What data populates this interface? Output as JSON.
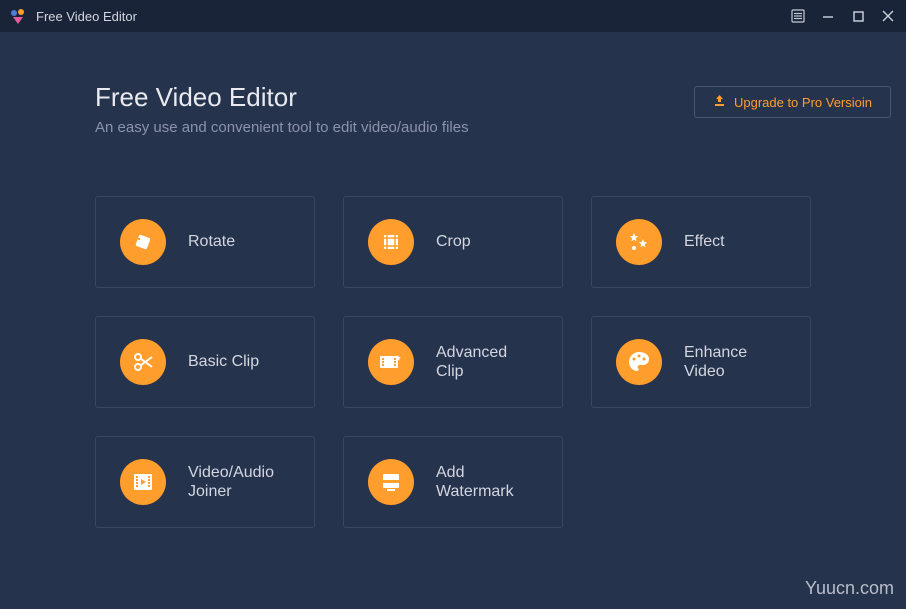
{
  "titlebar": {
    "app_name": "Free Video Editor"
  },
  "header": {
    "title": "Free Video Editor",
    "subtitle": "An easy use and convenient tool to edit video/audio files",
    "upgrade_label": "Upgrade to Pro Versioin"
  },
  "tools": [
    {
      "label": "Rotate",
      "icon": "rotate-icon"
    },
    {
      "label": "Crop",
      "icon": "crop-icon"
    },
    {
      "label": "Effect",
      "icon": "effect-icon"
    },
    {
      "label": "Basic Clip",
      "icon": "scissors-icon"
    },
    {
      "label": "Advanced Clip",
      "icon": "advanced-clip-icon"
    },
    {
      "label": "Enhance Video",
      "icon": "palette-icon"
    },
    {
      "label": "Video/Audio Joiner",
      "icon": "joiner-icon"
    },
    {
      "label": "Add Watermark",
      "icon": "watermark-icon"
    }
  ],
  "watermark_text": "Yuucn.com",
  "colors": {
    "accent": "#ff9e2c",
    "bg": "#26334d",
    "titlebar_bg": "#1a2438"
  }
}
